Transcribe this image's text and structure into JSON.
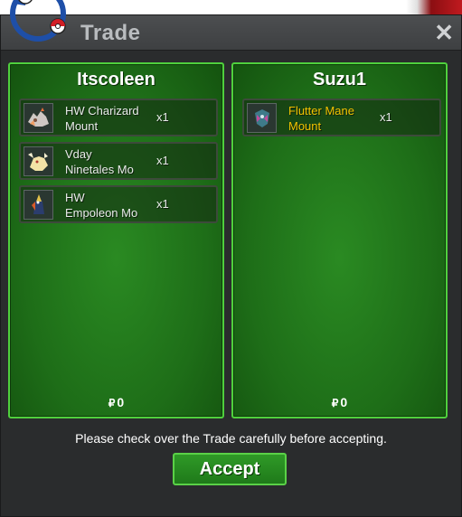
{
  "window": {
    "title": "Trade",
    "close_label": "✕"
  },
  "left_panel": {
    "player": "Itscoleen",
    "items": [
      {
        "name": "HW Charizard\nMount",
        "qty": "x1",
        "color": "#e9ecea"
      },
      {
        "name": "Vday\nNinetales Mo",
        "qty": "x1",
        "color": "#e9ecea"
      },
      {
        "name": "HW\nEmpoleon Mo",
        "qty": "x1",
        "color": "#e9ecea"
      }
    ],
    "money": "0",
    "money_icon": "coin-icon"
  },
  "right_panel": {
    "player": "Suzu1",
    "items": [
      {
        "name": "Flutter Mane\nMount",
        "qty": "x1",
        "color": "#f2c200"
      }
    ],
    "money": "0",
    "money_icon": "coin-icon"
  },
  "notice": "Please check over the Trade carefully before accepting.",
  "accept_label": "Accept",
  "colors": {
    "panel_green": "#1e6e18",
    "panel_border": "#4fd03d",
    "window_bg": "#2a2c2d",
    "gold_text": "#f2c200"
  }
}
